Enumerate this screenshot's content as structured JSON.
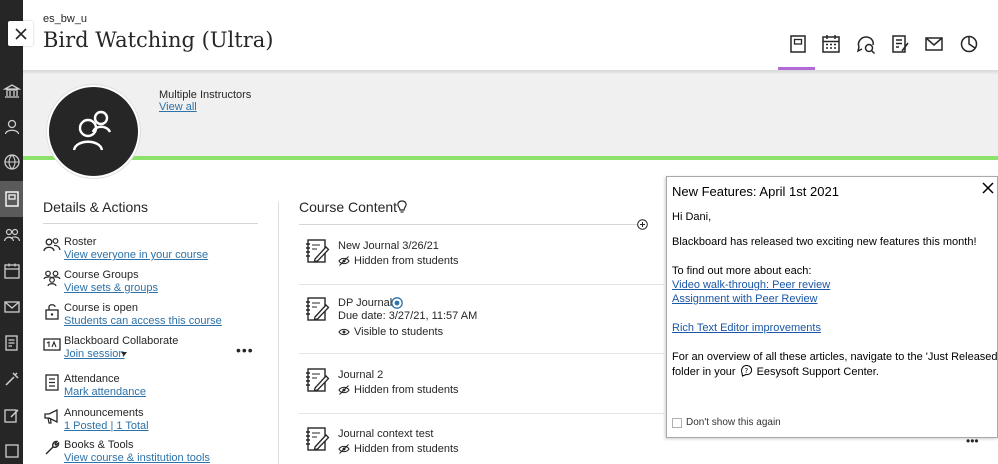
{
  "header": {
    "course_id": "es_bw_u",
    "title": "Bird Watching (Ultra)"
  },
  "banner": {
    "instructors_label": "Multiple Instructors",
    "view_all": "View all"
  },
  "details": {
    "heading": "Details & Actions",
    "items": [
      {
        "title": "Roster",
        "link": "View everyone in your course"
      },
      {
        "title": "Course Groups",
        "link": "View sets & groups"
      },
      {
        "title": "Course is open",
        "link": "Students can access this course"
      },
      {
        "title": "Blackboard Collaborate",
        "link": "Join session"
      },
      {
        "title": "Attendance",
        "link": "Mark attendance"
      },
      {
        "title": "Announcements",
        "link": "1 Posted | 1 Total"
      },
      {
        "title": "Books & Tools",
        "link": "View course & institution tools"
      }
    ],
    "more": "•••"
  },
  "content": {
    "heading": "Course Content",
    "items": [
      {
        "title": "New Journal 3/26/21",
        "due": "",
        "visibility": "Hidden from students"
      },
      {
        "title": "DP Journal",
        "due": "Due date: 3/27/21, 11:57 AM",
        "visibility": "Visible to students"
      },
      {
        "title": "Journal 2",
        "due": "",
        "visibility": "Hidden from students"
      },
      {
        "title": "Journal context test",
        "due": "",
        "visibility": "Hidden from students"
      }
    ]
  },
  "modal": {
    "title": "New Features: April 1st 2021",
    "greeting": "Hi Dani,",
    "intro": "Blackboard has released two exciting new features this month!",
    "find_out": "To find out more about each:",
    "link1": "Video walk-through: Peer review",
    "link2": "Assignment with Peer Review",
    "link3": "Rich Text Editor improvements",
    "overview_line1": "For an overview of all these articles, navigate to the 'Just Released",
    "overview_line2_pre": "folder in your",
    "overview_line2_post": "Eesysoft Support Center.",
    "dont_show": "Don't show this again"
  },
  "colors": {
    "accent_tab": "#b069d6",
    "banner_line": "#8ce26b",
    "link": "#2d72a8",
    "nav_bg": "#262626"
  },
  "icons": {
    "tabs": [
      "course-content-icon",
      "calendar-icon",
      "discussions-icon",
      "gradebook-icon",
      "messages-icon",
      "analytics-icon"
    ]
  }
}
